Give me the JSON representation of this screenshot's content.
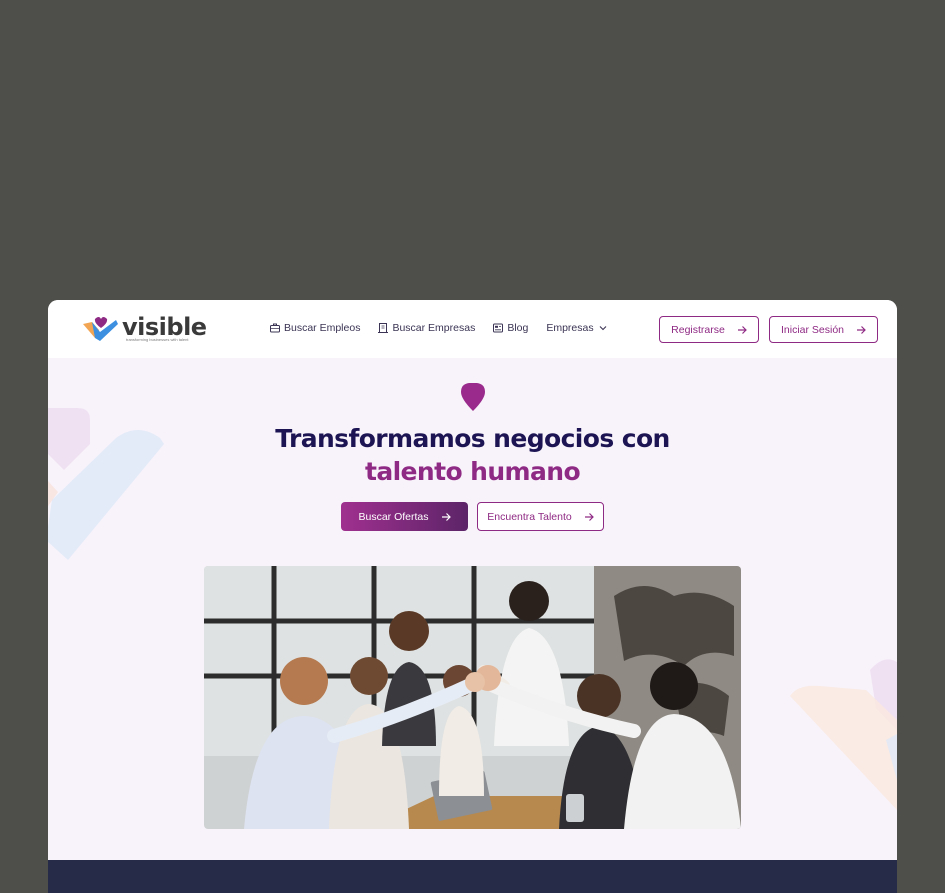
{
  "brand": {
    "name": "visible",
    "tagline": "transforming businesses with talent",
    "colors": {
      "primary": "#8f2a84",
      "navy": "#1d1553",
      "blue": "#3d8fe0",
      "orange": "#f2a654"
    }
  },
  "nav": {
    "items": [
      {
        "label": "Buscar Empleos",
        "icon": "briefcase-icon"
      },
      {
        "label": "Buscar Empresas",
        "icon": "building-icon"
      },
      {
        "label": "Blog",
        "icon": "newspaper-icon"
      },
      {
        "label": "Empresas",
        "icon": "chevron-down-icon"
      }
    ]
  },
  "header": {
    "register_label": "Registrarse",
    "login_label": "Iniciar Sesión"
  },
  "hero": {
    "title_line1": "Transformamos negocios con",
    "title_line2": "talento humano",
    "primary_cta": "Buscar Ofertas",
    "secondary_cta": "Encuentra Talento",
    "image": "team-high-five-photo"
  }
}
